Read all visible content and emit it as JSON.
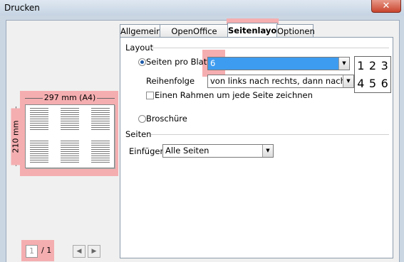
{
  "window": {
    "title": "Drucken",
    "close_glyph": "✕"
  },
  "preview": {
    "width_label": "297 mm (A4)",
    "height_label": "210 mm",
    "page_input": "1",
    "page_total": "/ 1"
  },
  "tabs": [
    {
      "label": "Allgemein",
      "active": false
    },
    {
      "label": "OpenOffice Writer",
      "active": false
    },
    {
      "label": "Seitenlayout",
      "active": true
    },
    {
      "label": "Optionen",
      "active": false
    }
  ],
  "layout": {
    "section_title": "Layout",
    "pages_per_sheet_label": "Seiten pro Blatt",
    "pages_per_sheet_value": "6",
    "order_label": "Reihenfolge",
    "order_value": "von links nach rechts, dann nach unten",
    "border_checkbox_label": "Einen Rahmen um jede Seite zeichnen",
    "brochure_label": "Broschüre",
    "order_preview": [
      "1",
      "2",
      "3",
      "4",
      "5",
      "6"
    ]
  },
  "pages": {
    "section_title": "Seiten",
    "insert_label": "Einfügen",
    "insert_value": "Alle Seiten"
  },
  "icons": {
    "dropdown_arrow": "▼",
    "prev": "◀",
    "next": "▶"
  }
}
